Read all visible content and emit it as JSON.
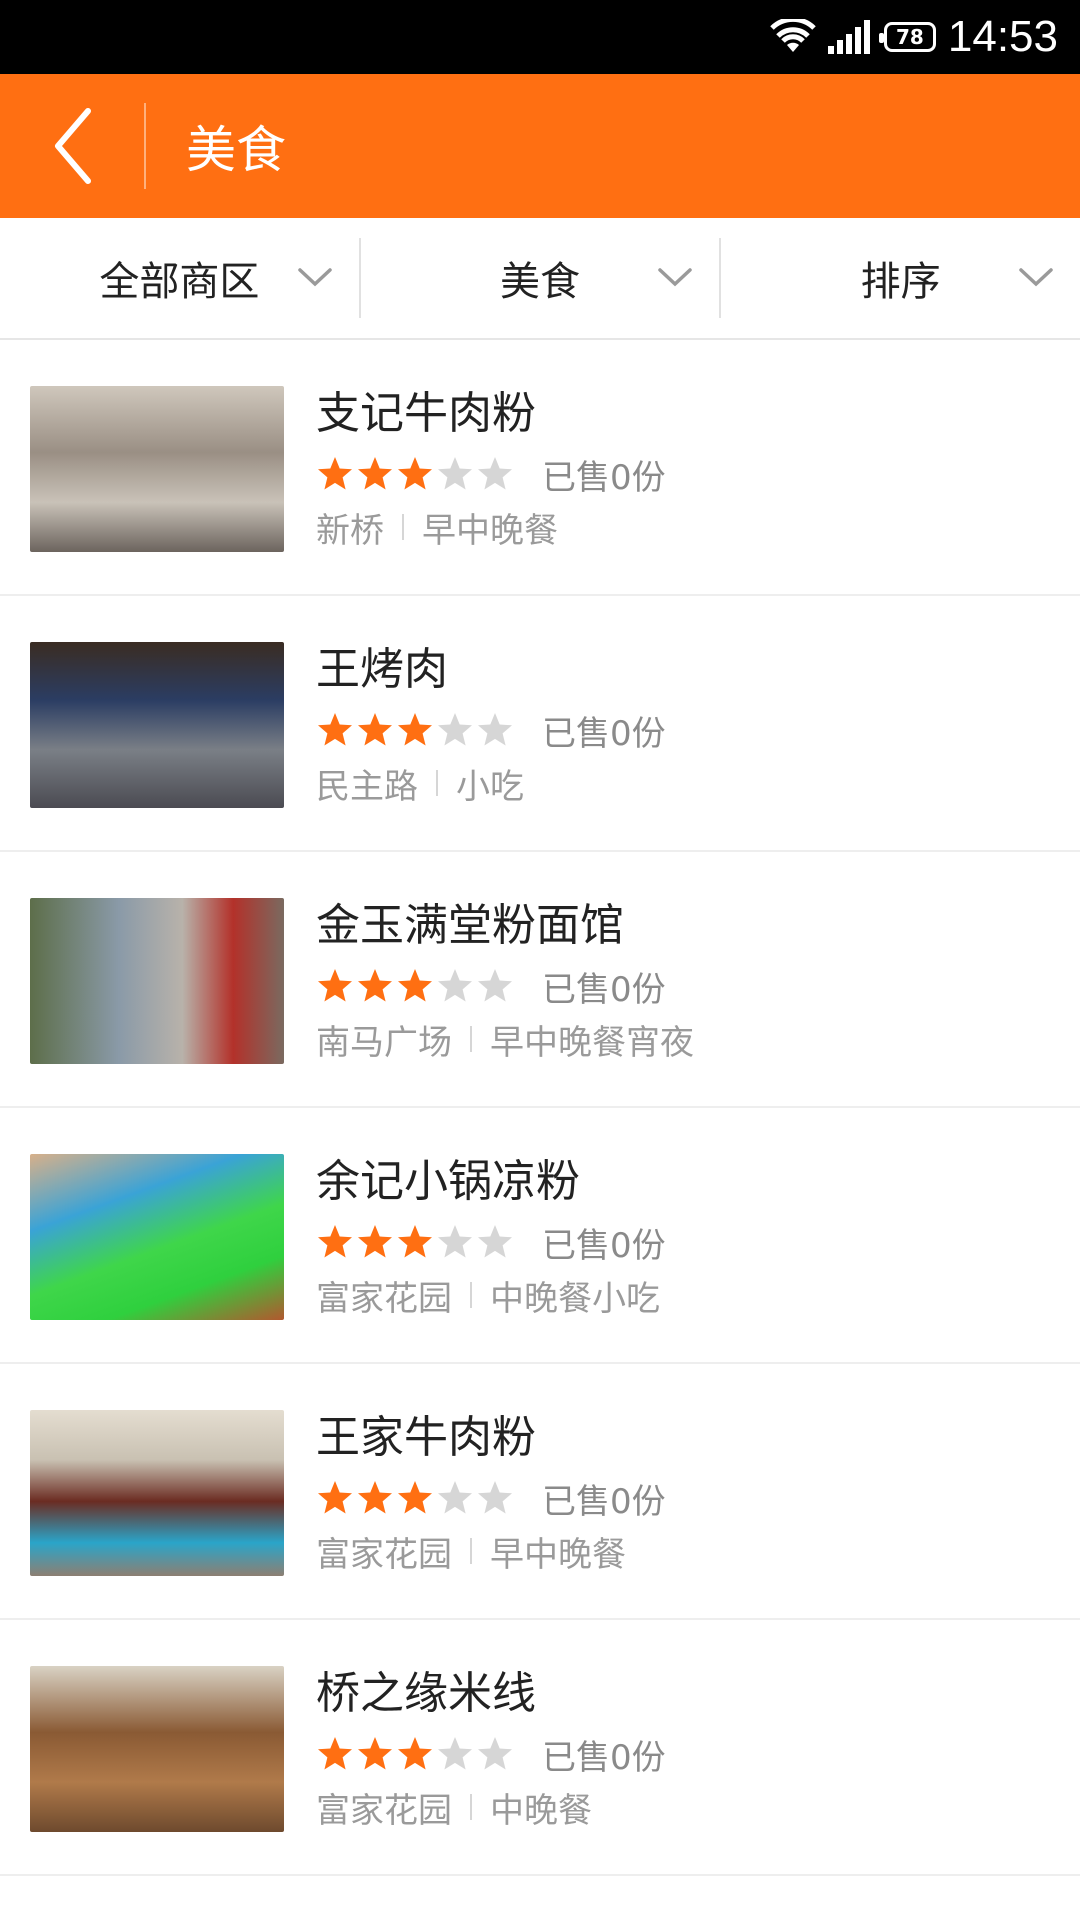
{
  "status_bar": {
    "time": "14:53",
    "battery": "78"
  },
  "header": {
    "title": "美食",
    "back_icon": "chevron-left-icon"
  },
  "filters": [
    {
      "label": "全部商区"
    },
    {
      "label": "美食"
    },
    {
      "label": "排序"
    }
  ],
  "colors": {
    "accent": "#ff6f12",
    "star_on": "#ff6f12",
    "star_off": "#d6d6d6"
  },
  "list": [
    {
      "name": "支记牛肉粉",
      "rating": 3,
      "max_rating": 5,
      "sold": "已售0份",
      "area": "新桥",
      "category": "早中晚餐"
    },
    {
      "name": "王烤肉",
      "rating": 3,
      "max_rating": 5,
      "sold": "已售0份",
      "area": "民主路",
      "category": "小吃"
    },
    {
      "name": "金玉满堂粉面馆",
      "rating": 3,
      "max_rating": 5,
      "sold": "已售0份",
      "area": "南马广场",
      "category": "早中晚餐宵夜"
    },
    {
      "name": "余记小锅凉粉",
      "rating": 3,
      "max_rating": 5,
      "sold": "已售0份",
      "area": "富家花园",
      "category": "中晚餐小吃"
    },
    {
      "name": "王家牛肉粉",
      "rating": 3,
      "max_rating": 5,
      "sold": "已售0份",
      "area": "富家花园",
      "category": "早中晚餐"
    },
    {
      "name": "桥之缘米线",
      "rating": 3,
      "max_rating": 5,
      "sold": "已售0份",
      "area": "富家花园",
      "category": "中晚餐"
    }
  ]
}
